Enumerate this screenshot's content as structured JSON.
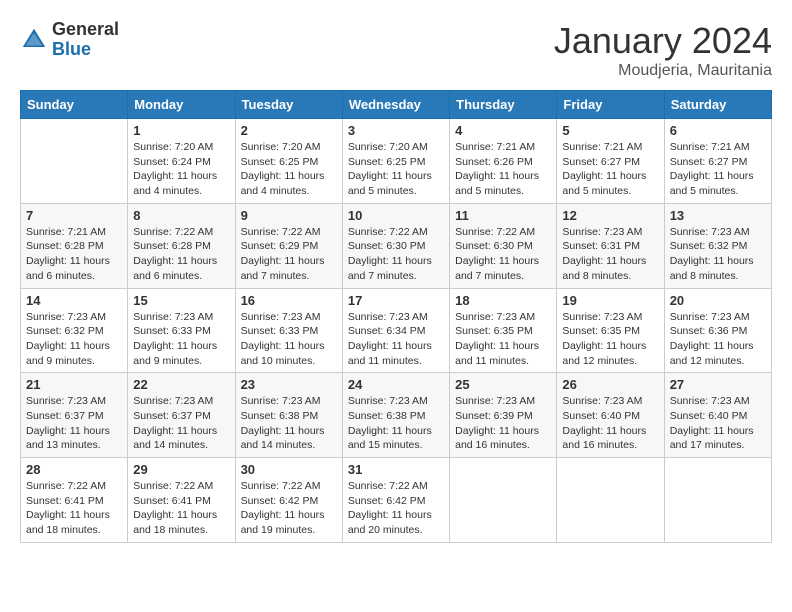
{
  "header": {
    "logo_general": "General",
    "logo_blue": "Blue",
    "month_year": "January 2024",
    "location": "Moudjeria, Mauritania"
  },
  "weekdays": [
    "Sunday",
    "Monday",
    "Tuesday",
    "Wednesday",
    "Thursday",
    "Friday",
    "Saturday"
  ],
  "weeks": [
    [
      {
        "day": "",
        "sunrise": "",
        "sunset": "",
        "daylight": ""
      },
      {
        "day": "1",
        "sunrise": "7:20 AM",
        "sunset": "6:24 PM",
        "daylight": "11 hours and 4 minutes."
      },
      {
        "day": "2",
        "sunrise": "7:20 AM",
        "sunset": "6:25 PM",
        "daylight": "11 hours and 4 minutes."
      },
      {
        "day": "3",
        "sunrise": "7:20 AM",
        "sunset": "6:25 PM",
        "daylight": "11 hours and 5 minutes."
      },
      {
        "day": "4",
        "sunrise": "7:21 AM",
        "sunset": "6:26 PM",
        "daylight": "11 hours and 5 minutes."
      },
      {
        "day": "5",
        "sunrise": "7:21 AM",
        "sunset": "6:27 PM",
        "daylight": "11 hours and 5 minutes."
      },
      {
        "day": "6",
        "sunrise": "7:21 AM",
        "sunset": "6:27 PM",
        "daylight": "11 hours and 5 minutes."
      }
    ],
    [
      {
        "day": "7",
        "sunrise": "7:21 AM",
        "sunset": "6:28 PM",
        "daylight": "11 hours and 6 minutes."
      },
      {
        "day": "8",
        "sunrise": "7:22 AM",
        "sunset": "6:28 PM",
        "daylight": "11 hours and 6 minutes."
      },
      {
        "day": "9",
        "sunrise": "7:22 AM",
        "sunset": "6:29 PM",
        "daylight": "11 hours and 7 minutes."
      },
      {
        "day": "10",
        "sunrise": "7:22 AM",
        "sunset": "6:30 PM",
        "daylight": "11 hours and 7 minutes."
      },
      {
        "day": "11",
        "sunrise": "7:22 AM",
        "sunset": "6:30 PM",
        "daylight": "11 hours and 7 minutes."
      },
      {
        "day": "12",
        "sunrise": "7:23 AM",
        "sunset": "6:31 PM",
        "daylight": "11 hours and 8 minutes."
      },
      {
        "day": "13",
        "sunrise": "7:23 AM",
        "sunset": "6:32 PM",
        "daylight": "11 hours and 8 minutes."
      }
    ],
    [
      {
        "day": "14",
        "sunrise": "7:23 AM",
        "sunset": "6:32 PM",
        "daylight": "11 hours and 9 minutes."
      },
      {
        "day": "15",
        "sunrise": "7:23 AM",
        "sunset": "6:33 PM",
        "daylight": "11 hours and 9 minutes."
      },
      {
        "day": "16",
        "sunrise": "7:23 AM",
        "sunset": "6:33 PM",
        "daylight": "11 hours and 10 minutes."
      },
      {
        "day": "17",
        "sunrise": "7:23 AM",
        "sunset": "6:34 PM",
        "daylight": "11 hours and 11 minutes."
      },
      {
        "day": "18",
        "sunrise": "7:23 AM",
        "sunset": "6:35 PM",
        "daylight": "11 hours and 11 minutes."
      },
      {
        "day": "19",
        "sunrise": "7:23 AM",
        "sunset": "6:35 PM",
        "daylight": "11 hours and 12 minutes."
      },
      {
        "day": "20",
        "sunrise": "7:23 AM",
        "sunset": "6:36 PM",
        "daylight": "11 hours and 12 minutes."
      }
    ],
    [
      {
        "day": "21",
        "sunrise": "7:23 AM",
        "sunset": "6:37 PM",
        "daylight": "11 hours and 13 minutes."
      },
      {
        "day": "22",
        "sunrise": "7:23 AM",
        "sunset": "6:37 PM",
        "daylight": "11 hours and 14 minutes."
      },
      {
        "day": "23",
        "sunrise": "7:23 AM",
        "sunset": "6:38 PM",
        "daylight": "11 hours and 14 minutes."
      },
      {
        "day": "24",
        "sunrise": "7:23 AM",
        "sunset": "6:38 PM",
        "daylight": "11 hours and 15 minutes."
      },
      {
        "day": "25",
        "sunrise": "7:23 AM",
        "sunset": "6:39 PM",
        "daylight": "11 hours and 16 minutes."
      },
      {
        "day": "26",
        "sunrise": "7:23 AM",
        "sunset": "6:40 PM",
        "daylight": "11 hours and 16 minutes."
      },
      {
        "day": "27",
        "sunrise": "7:23 AM",
        "sunset": "6:40 PM",
        "daylight": "11 hours and 17 minutes."
      }
    ],
    [
      {
        "day": "28",
        "sunrise": "7:22 AM",
        "sunset": "6:41 PM",
        "daylight": "11 hours and 18 minutes."
      },
      {
        "day": "29",
        "sunrise": "7:22 AM",
        "sunset": "6:41 PM",
        "daylight": "11 hours and 18 minutes."
      },
      {
        "day": "30",
        "sunrise": "7:22 AM",
        "sunset": "6:42 PM",
        "daylight": "11 hours and 19 minutes."
      },
      {
        "day": "31",
        "sunrise": "7:22 AM",
        "sunset": "6:42 PM",
        "daylight": "11 hours and 20 minutes."
      },
      {
        "day": "",
        "sunrise": "",
        "sunset": "",
        "daylight": ""
      },
      {
        "day": "",
        "sunrise": "",
        "sunset": "",
        "daylight": ""
      },
      {
        "day": "",
        "sunrise": "",
        "sunset": "",
        "daylight": ""
      }
    ]
  ]
}
